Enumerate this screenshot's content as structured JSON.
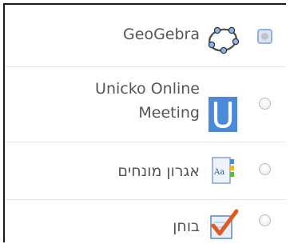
{
  "activities": [
    {
      "name": "GeoGebra",
      "icon": "geogebra-icon"
    },
    {
      "name_line1": "Unicko Online",
      "name_line2": "Meeting",
      "icon": "unicko-icon"
    },
    {
      "name": "אגרון מונחים",
      "icon": "glossary-icon",
      "icon_text": "Aa"
    },
    {
      "name": "בוחן",
      "icon": "quiz-icon"
    }
  ],
  "colors": {
    "accent_blue": "#4a8ad8",
    "quiz_check": "#e05a1e",
    "text": "#555555"
  }
}
